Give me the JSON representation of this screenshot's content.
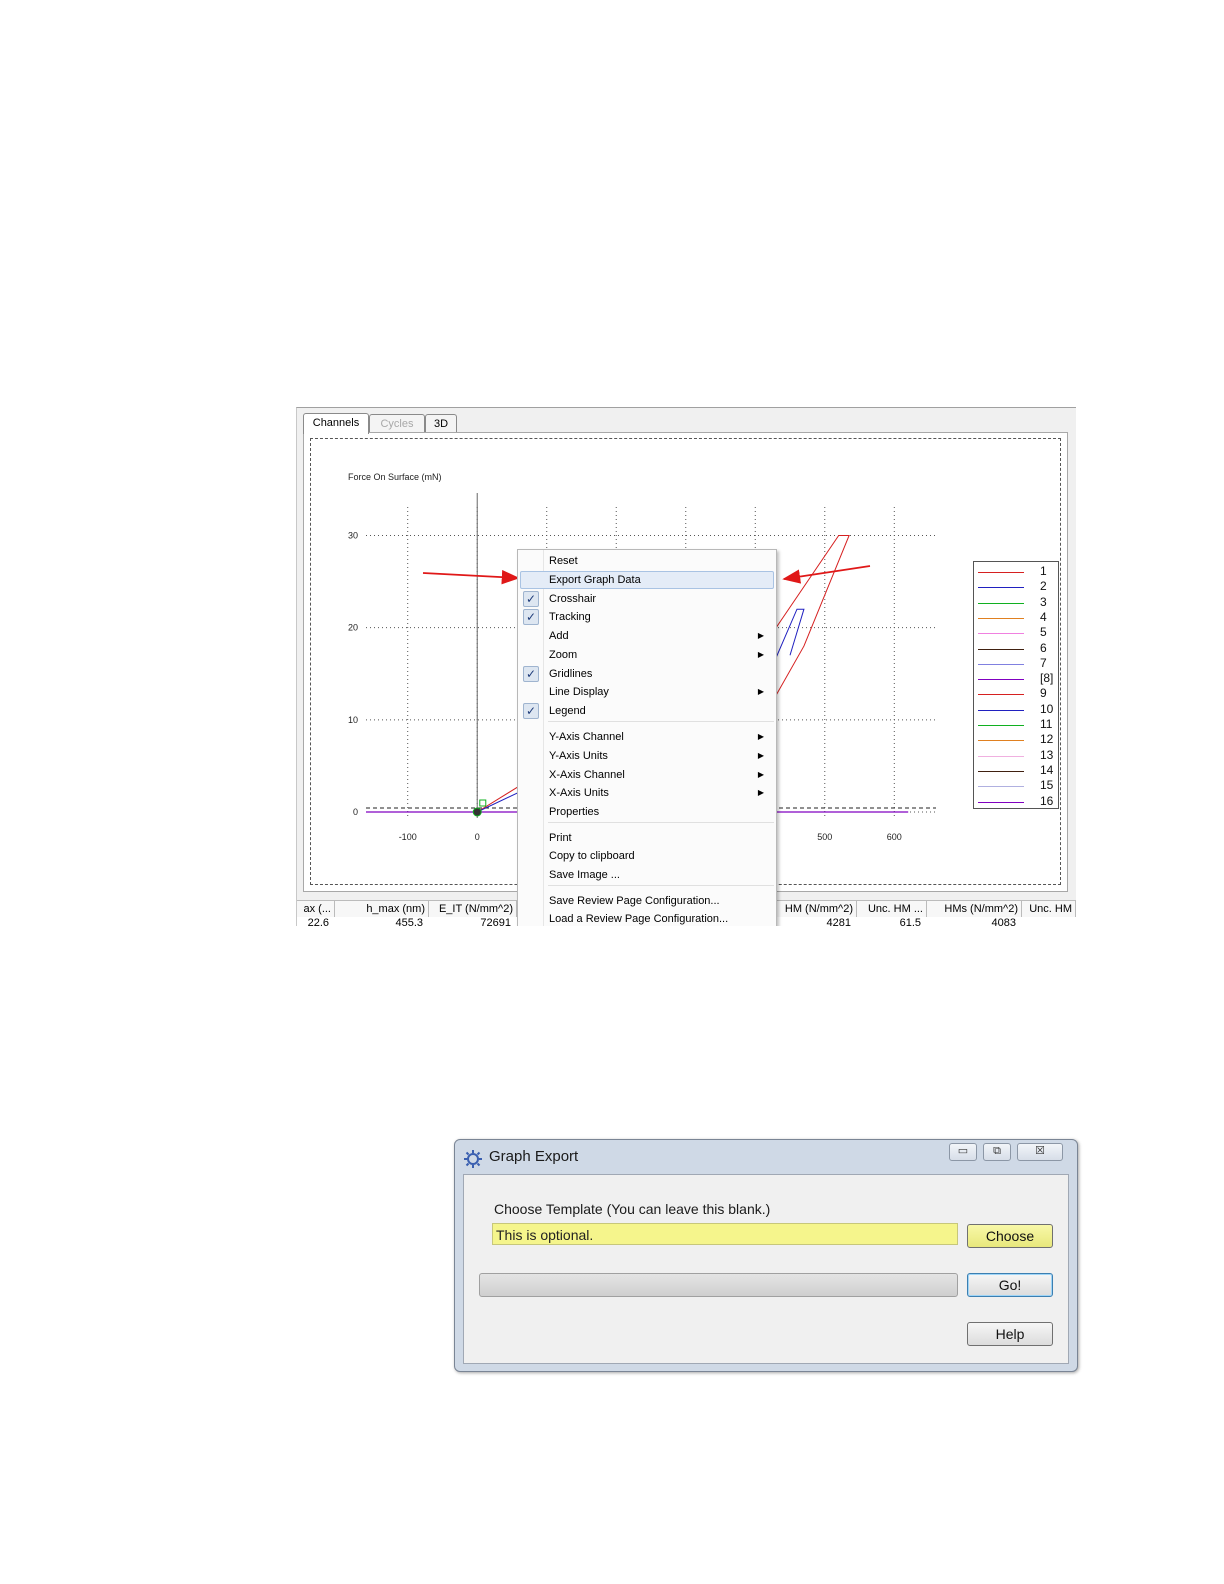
{
  "graph_window": {
    "tabs": [
      {
        "label": "Channels",
        "state": "active"
      },
      {
        "label": "Cycles",
        "state": "disabled"
      },
      {
        "label": "3D",
        "state": "normal"
      }
    ],
    "chart_data": {
      "type": "line",
      "ylabel": "Force On Surface (mN)",
      "xlabel": "",
      "x_ticks": [
        -100,
        0,
        500,
        600
      ],
      "y_ticks": [
        0,
        10,
        20,
        30
      ],
      "xlim": [
        -160,
        660
      ],
      "ylim": [
        0,
        32
      ],
      "grid": true,
      "legend": "right",
      "series": [
        {
          "name": "1",
          "color": "#d62020"
        },
        {
          "name": "2",
          "color": "#2020c0"
        },
        {
          "name": "3",
          "color": "#10b020"
        },
        {
          "name": "4",
          "color": "#e08020"
        },
        {
          "name": "5",
          "color": "#f080e0"
        },
        {
          "name": "6",
          "color": "#402010"
        },
        {
          "name": "7",
          "color": "#8080e0"
        },
        {
          "name": "[8]",
          "color": "#8000c0"
        },
        {
          "name": "9",
          "color": "#d62020"
        },
        {
          "name": "10",
          "color": "#2020c0"
        },
        {
          "name": "11",
          "color": "#10b020"
        },
        {
          "name": "12",
          "color": "#e08020"
        },
        {
          "name": "13",
          "color": "#f0b0e0"
        },
        {
          "name": "14",
          "color": "#402010"
        },
        {
          "name": "15",
          "color": "#b0b0e0"
        },
        {
          "name": "16",
          "color": "#8000c0"
        }
      ]
    },
    "context_menu": {
      "items": [
        {
          "label": "Reset",
          "checked": false,
          "submenu": false
        },
        {
          "label": "Export Graph Data",
          "checked": false,
          "submenu": false,
          "highlighted": true
        },
        {
          "label": "Crosshair",
          "checked": true,
          "submenu": false
        },
        {
          "label": "Tracking",
          "checked": true,
          "submenu": false
        },
        {
          "label": "Add",
          "checked": false,
          "submenu": true
        },
        {
          "label": "Zoom",
          "checked": false,
          "submenu": true
        },
        {
          "label": "Gridlines",
          "checked": true,
          "submenu": false
        },
        {
          "label": "Line Display",
          "checked": false,
          "submenu": true
        },
        {
          "label": "Legend",
          "checked": true,
          "submenu": false
        },
        {
          "label": "Y-Axis Channel",
          "checked": false,
          "submenu": true
        },
        {
          "label": "Y-Axis Units",
          "checked": false,
          "submenu": true
        },
        {
          "label": "X-Axis Channel",
          "checked": false,
          "submenu": true
        },
        {
          "label": "X-Axis Units",
          "checked": false,
          "submenu": true
        },
        {
          "label": "Properties",
          "checked": false,
          "submenu": false
        },
        {
          "label": "Print",
          "checked": false,
          "submenu": false
        },
        {
          "label": "Copy to clipboard",
          "checked": false,
          "submenu": false
        },
        {
          "label": "Save Image ...",
          "checked": false,
          "submenu": false
        },
        {
          "label": "Save Review Page Configuration...",
          "checked": false,
          "submenu": false
        },
        {
          "label": "Load a Review Page Configuration...",
          "checked": false,
          "submenu": false
        }
      ],
      "check_glyph": "✓",
      "arrow_glyph": "▶"
    },
    "results_grid": {
      "headers": [
        "ax (...",
        "h_max (nm)",
        "E_IT (N/mm^2)",
        "HM (N/mm^2)",
        "Unc. HM ...",
        "HMs (N/mm^2)",
        "Unc. HM"
      ],
      "row": [
        "22.6",
        "455.3",
        "72691",
        "4281",
        "61.5",
        "4083",
        ""
      ]
    }
  },
  "graph_export_dialog": {
    "title": "Graph Export",
    "icon": "gear-icon",
    "window_buttons": {
      "minimize": "▭",
      "restore": "⧉",
      "close": "☒"
    },
    "template_label": "Choose Template (You can leave this blank.)",
    "template_value": "This is optional.",
    "choose_label": "Choose",
    "go_label": "Go!",
    "help_label": "Help",
    "progress": 0
  }
}
